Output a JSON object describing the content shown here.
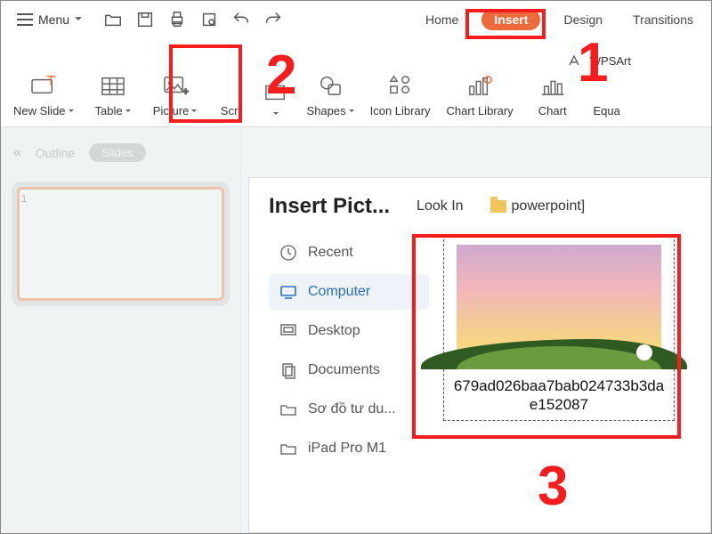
{
  "menu": {
    "label": "Menu"
  },
  "tabs": {
    "home": "Home",
    "insert": "Insert",
    "design": "Design",
    "transitions": "Transitions"
  },
  "ribbon": {
    "newslide": "New Slide",
    "table": "Table",
    "picture": "Picture",
    "scr": "Scr",
    "shapes": "Shapes",
    "iconlib": "Icon Library",
    "chartlib": "Chart Library",
    "chart": "Chart",
    "wpsart": "WPSArt",
    "equation": "Equa"
  },
  "leftpane": {
    "tab_outline": "Outline",
    "tab_slides": "Slides",
    "slide1_num": "1"
  },
  "dialog": {
    "title": "Insert Pict...",
    "look_in_label": "Look In",
    "folder_label": "powerpoint]",
    "locations": {
      "recent": "Recent",
      "computer": "Computer",
      "desktop": "Desktop",
      "documents": "Documents",
      "item5": "Sơ đồ tư du...",
      "item6": "iPad Pro M1"
    },
    "file": {
      "name": "679ad026baa7bab024733b3dae152087"
    }
  },
  "annotations": {
    "n1": "1",
    "n2": "2",
    "n3": "3"
  }
}
